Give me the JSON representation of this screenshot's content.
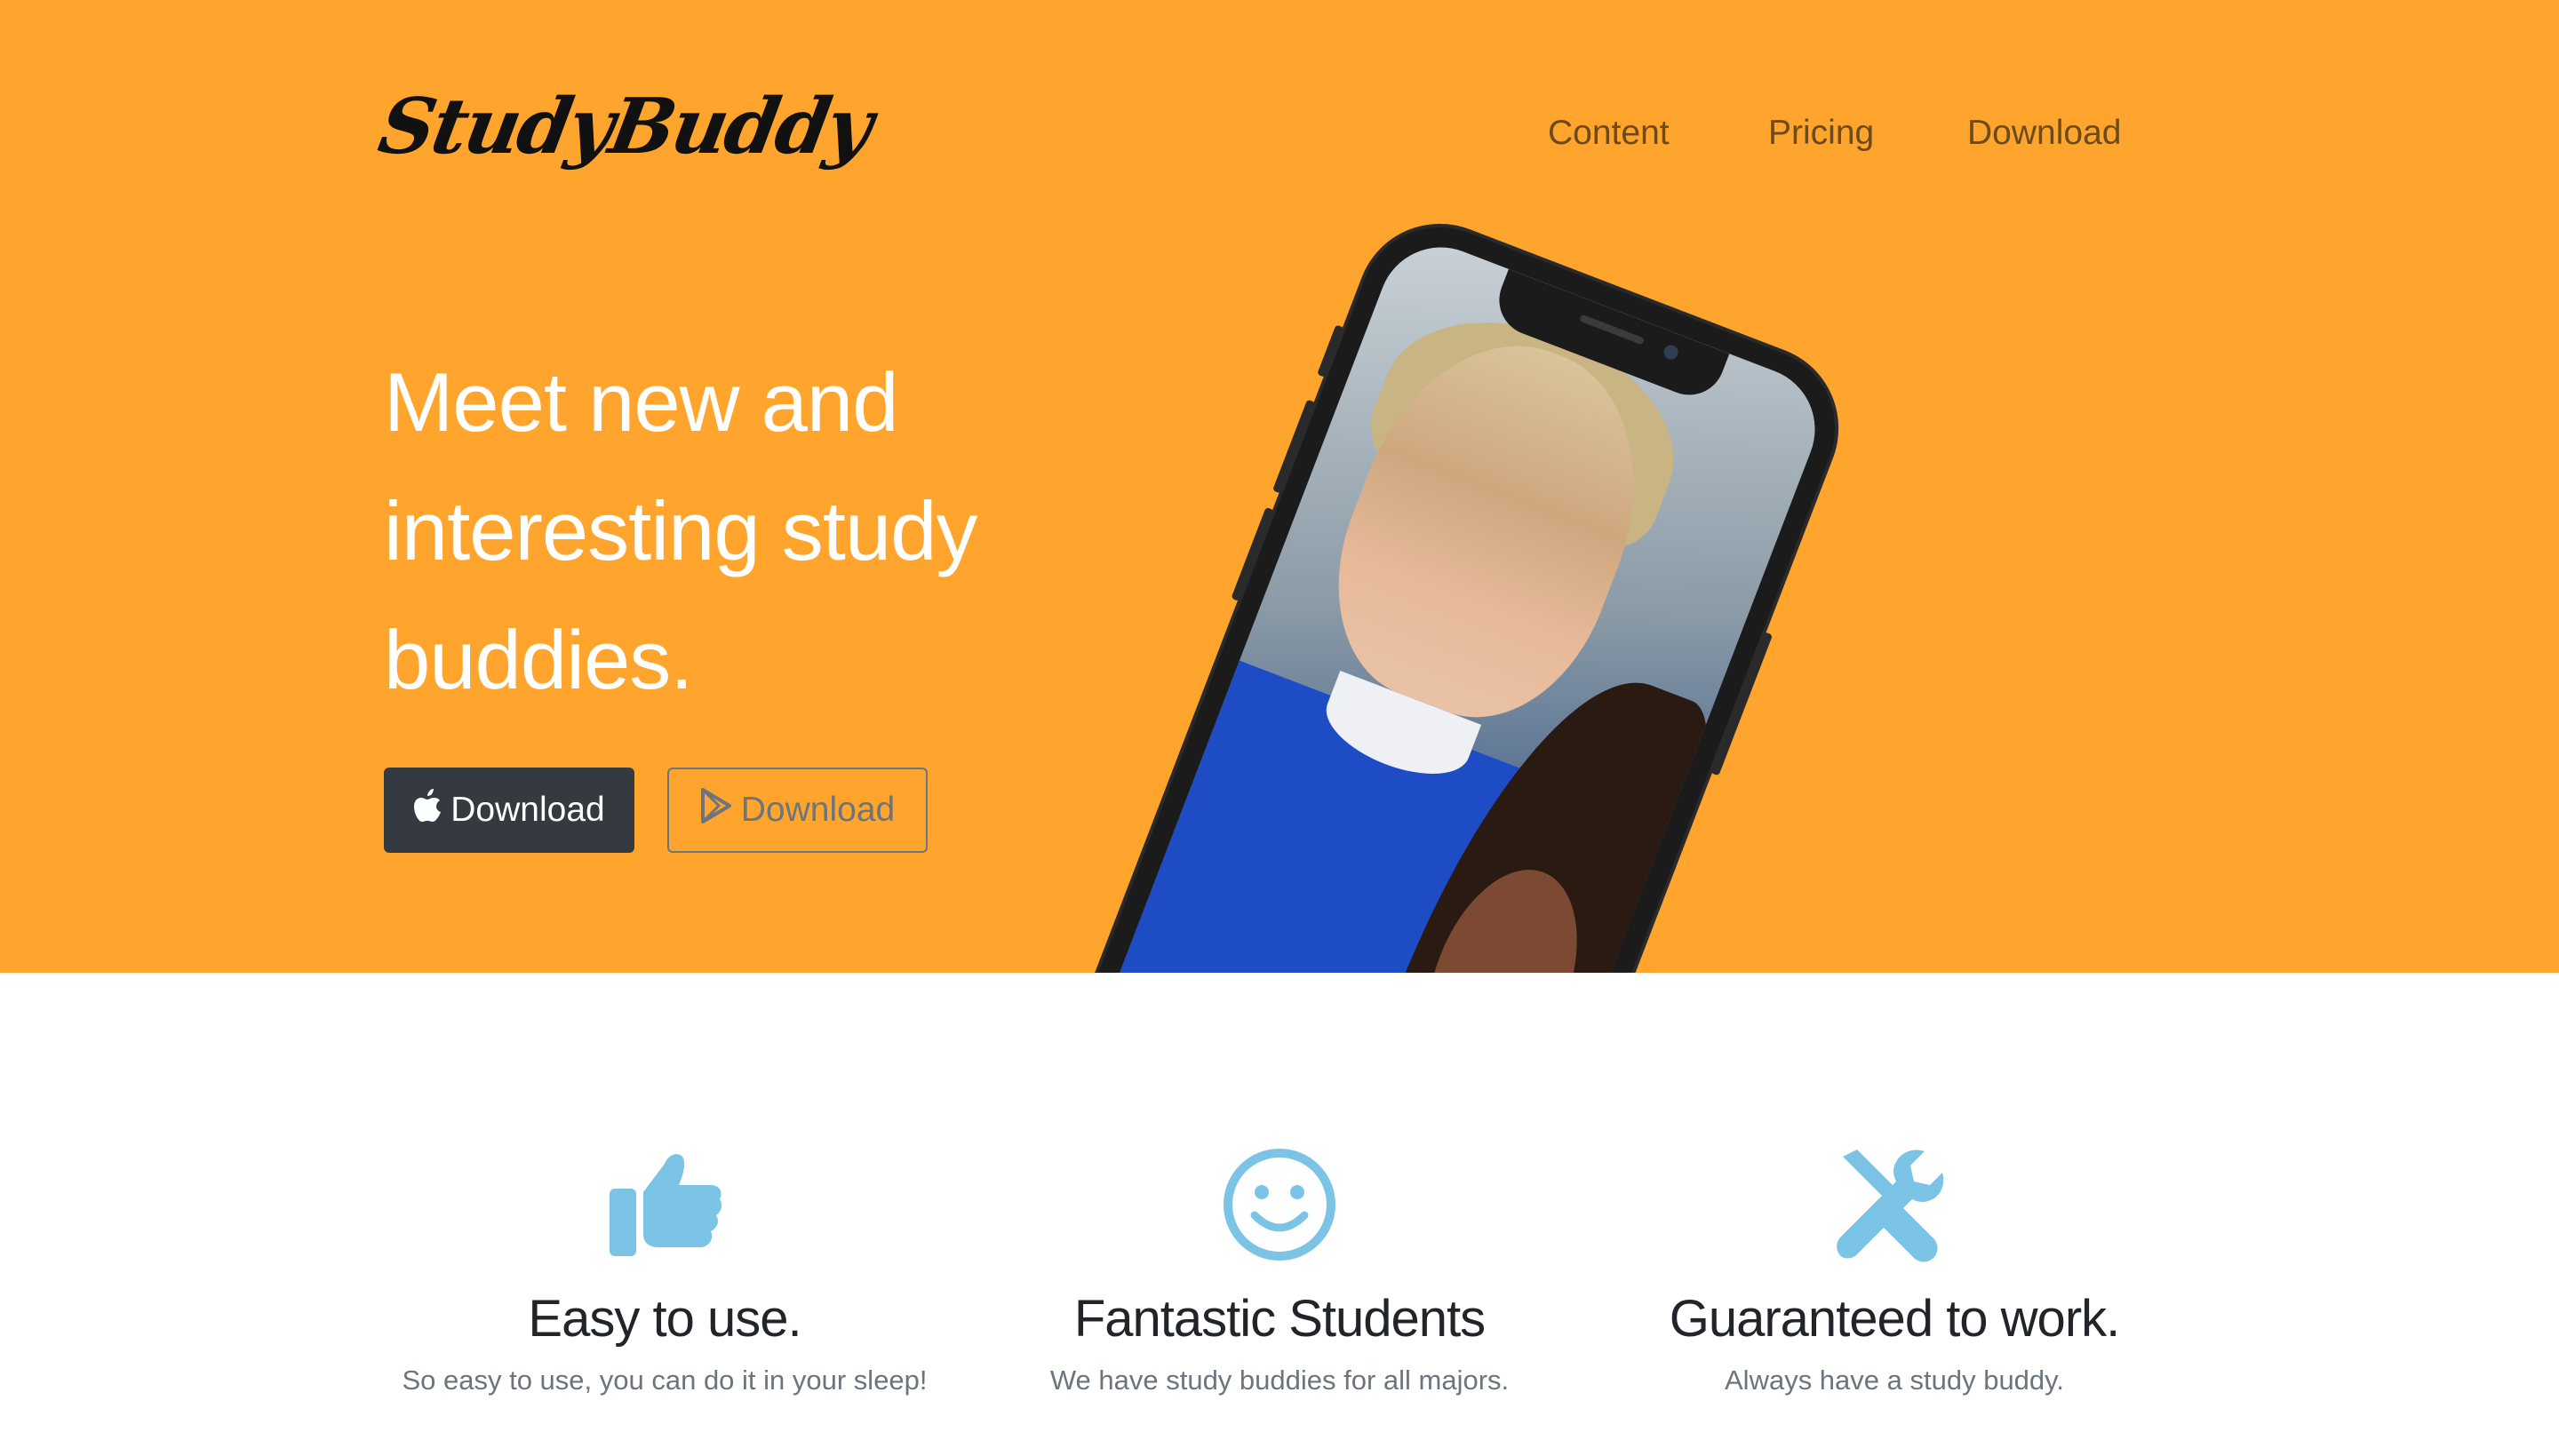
{
  "header": {
    "brand": "StudyBuddy",
    "nav": [
      "Content",
      "Pricing",
      "Download"
    ]
  },
  "hero": {
    "title": "Meet new and interesting study buddies.",
    "buttons": [
      {
        "label": "Download",
        "icon": "apple-icon"
      },
      {
        "label": "Download",
        "icon": "google-play-icon"
      }
    ],
    "image": "phone-mockup-with-two-students-photo"
  },
  "features": [
    {
      "icon": "thumbs-up-icon",
      "title": "Easy to use.",
      "text": "So easy to use, you can do it in your sleep!"
    },
    {
      "icon": "smile-icon",
      "title": "Fantastic Students",
      "text": "We have study buddies for all majors."
    },
    {
      "icon": "tools-icon",
      "title": "Guaranteed to work.",
      "text": "Always have a study buddy."
    }
  ],
  "colors": {
    "hero_bg": "#ffa42c",
    "icon_accent": "#7cc4e6",
    "dark_button": "#343a40"
  }
}
